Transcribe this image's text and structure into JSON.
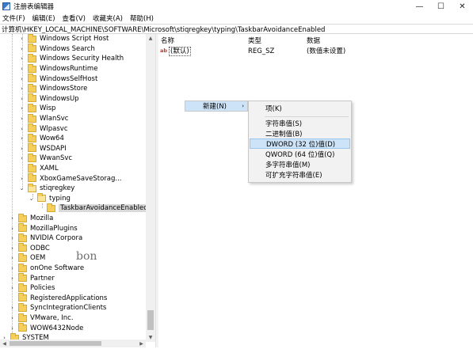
{
  "window": {
    "title": "注册表编辑器",
    "minimize": "—",
    "maximize": "☐",
    "close": "✕"
  },
  "menu": [
    "文件(F)",
    "编辑(E)",
    "查看(V)",
    "收藏夹(A)",
    "帮助(H)"
  ],
  "address": "计算机\\HKEY_LOCAL_MACHINE\\SOFTWARE\\Microsoft\\stiqregkey\\typing\\TaskbarAvoidanceEnabled",
  "tree": [
    {
      "label": "Windows Script Host",
      "expander": "›"
    },
    {
      "label": "Windows Search",
      "expander": "›"
    },
    {
      "label": "Windows Security Health",
      "expander": "›"
    },
    {
      "label": "WindowsRuntime",
      "expander": "›"
    },
    {
      "label": "WindowsSelfHost",
      "expander": "›"
    },
    {
      "label": "WindowsStore",
      "expander": "›"
    },
    {
      "label": "WindowsUp",
      "expander": "›"
    },
    {
      "label": "Wisp",
      "expander": "›"
    },
    {
      "label": "WlanSvc",
      "expander": "›"
    },
    {
      "label": "Wlpasvc",
      "expander": "›"
    },
    {
      "label": "Wow64",
      "expander": "›"
    },
    {
      "label": "WSDAPI",
      "expander": "›"
    },
    {
      "label": "WwanSvc",
      "expander": "›"
    },
    {
      "label": "XAML",
      "expander": ""
    },
    {
      "label": "XboxGameSaveStorag...",
      "expander": "›"
    },
    {
      "label": "stiqregkey",
      "expander": "⌄"
    },
    {
      "label": "typing",
      "expander": "⌄"
    },
    {
      "label": "TaskbarAvoidanceEnabled",
      "expander": ""
    },
    {
      "label": "Mozilla",
      "expander": "›"
    },
    {
      "label": "MozillaPlugins",
      "expander": "›"
    },
    {
      "label": "NVIDIA Corpora",
      "expander": "›"
    },
    {
      "label": "ODBC",
      "expander": "›"
    },
    {
      "label": "OEM",
      "expander": "›"
    },
    {
      "label": "onOne Software",
      "expander": "›"
    },
    {
      "label": "Partner",
      "expander": "›"
    },
    {
      "label": "Policies",
      "expander": "›"
    },
    {
      "label": "RegisteredApplications",
      "expander": ""
    },
    {
      "label": "SyncIntegrationClients",
      "expander": "›"
    },
    {
      "label": "VMware, Inc.",
      "expander": "›"
    },
    {
      "label": "WOW6432Node",
      "expander": "›"
    },
    {
      "label": "SYSTEM",
      "expander": "›"
    }
  ],
  "columns": {
    "name": "名称",
    "type": "类型",
    "data": "数据"
  },
  "values": [
    {
      "icon": "ab",
      "name": "(默认)",
      "type": "REG_SZ",
      "data": "(数值未设置)"
    }
  ],
  "context_menu": {
    "item": "新建(N)",
    "arrow": "›"
  },
  "submenu": [
    {
      "label": "项(K)",
      "highlighted": false
    },
    {
      "label": "字符串值(S)",
      "highlighted": false
    },
    {
      "label": "二进制值(B)",
      "highlighted": false
    },
    {
      "label": "DWORD (32 位)值(D)",
      "highlighted": true
    },
    {
      "label": "QWORD (64 位)值(Q)",
      "highlighted": false
    },
    {
      "label": "多字符串值(M)",
      "highlighted": false
    },
    {
      "label": "可扩充字符串值(E)",
      "highlighted": false
    }
  ],
  "watermark": "bon",
  "scroll_arrows": {
    "up": "▲",
    "down": "▼",
    "left": "◀",
    "right": "▶"
  }
}
